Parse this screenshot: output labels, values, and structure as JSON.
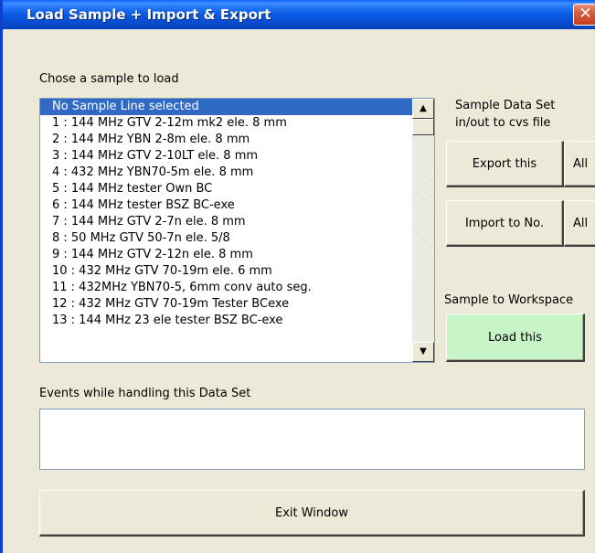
{
  "window": {
    "title": "Load Sample + Import & Export",
    "close_glyph": "✕"
  },
  "list": {
    "label": "Chose a sample to load",
    "items": [
      "No Sample Line selected",
      "1 : 144 MHz GTV 2-12m mk2 ele. 8 mm",
      "2 : 144 MHz YBN 2-8m ele. 8 mm",
      "3 : 144 MHz GTV 2-10LT ele. 8 mm",
      "4 : 432 MHz YBN70-5m ele. 8 mm",
      "5 : 144 MHz tester Own BC",
      "6 : 144 MHz tester BSZ BC-exe",
      "7 : 144 MHz GTV 2-7n ele. 8 mm",
      "8 : 50 MHz GTV 50-7n ele. 5/8",
      "9 : 144 MHz GTV 2-12n ele. 8 mm",
      "10 : 432 MHz GTV 70-19m ele. 6 mm",
      "11 : 432MHz YBN70-5, 6mm conv auto seg.",
      "12 : 432 MHz GTV 70-19m Tester BCexe",
      "13 : 144 MHz 23 ele tester BSZ BC-exe"
    ],
    "selected_index": 0,
    "scroll_up_glyph": "▲",
    "scroll_down_glyph": "▼"
  },
  "sample_data_set": {
    "label_line1": "Sample Data Set",
    "label_line2": "in/out to cvs file",
    "export_label": "Export this",
    "export_all_label": "All",
    "import_label": "Import to No.",
    "import_all_label": "All"
  },
  "workspace": {
    "label": "Sample to Workspace",
    "load_label": "Load this",
    "load_color": "#c8f5c8"
  },
  "events": {
    "label": "Events while handling this Data Set",
    "value": ""
  },
  "exit_label": "Exit Window",
  "colors": {
    "titlebar": "#0a5ff0",
    "selection": "#316ac5",
    "window_bg": "#ece9d8",
    "close_button": "#d95d3c"
  }
}
